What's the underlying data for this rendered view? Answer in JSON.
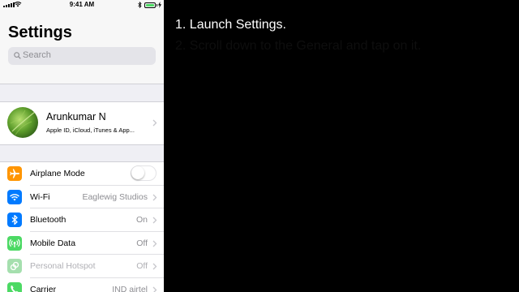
{
  "status_bar": {
    "time": "9:41 AM",
    "battery_level": 1.0
  },
  "settings": {
    "title": "Settings",
    "search_placeholder": "Search"
  },
  "profile": {
    "name": "Arunkumar N",
    "subtitle": "Apple ID, iCloud, iTunes & App..."
  },
  "rows": [
    {
      "label": "Airplane Mode",
      "icon": "airplane-icon",
      "color": "#ff9500",
      "toggle": false
    },
    {
      "label": "Wi-Fi",
      "value": "Eaglewig Studios",
      "icon": "wifi-icon",
      "color": "#007aff"
    },
    {
      "label": "Bluetooth",
      "value": "On",
      "icon": "bluetooth-icon",
      "color": "#007aff"
    },
    {
      "label": "Mobile Data",
      "value": "Off",
      "icon": "antenna-icon",
      "color": "#4cd964"
    },
    {
      "label": "Personal Hotspot",
      "value": "Off",
      "icon": "hotspot-icon",
      "color": "#a5dfae",
      "disabled": true
    },
    {
      "label": "Carrier",
      "value": "IND airtel",
      "icon": "phone-icon",
      "color": "#4cd964"
    }
  ],
  "instructions": {
    "step1": "1. Launch Settings.",
    "step2": "2. Scroll down to the General and tap on it."
  }
}
